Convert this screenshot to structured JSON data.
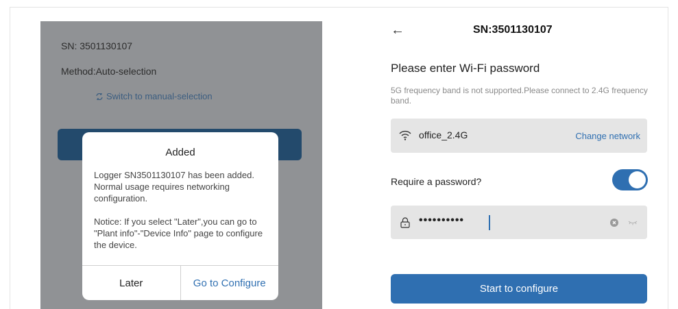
{
  "left": {
    "sn_text": "SN: 3501130107",
    "method_text": "Method:Auto-selection",
    "switch_label": "Switch to manual-selection",
    "dialog": {
      "title": "Added",
      "message": "Logger SN3501130107 has been added. Normal usage requires networking configuration.",
      "notice": "Notice: If you select \"Later\",you can go to \"Plant info\"-\"Device Info\" page to configure the device.",
      "later_label": "Later",
      "configure_label": "Go to Configure"
    }
  },
  "right": {
    "back_icon": "←",
    "header_title": "SN:3501130107",
    "title": "Please enter Wi-Fi password",
    "subtitle": "5G frequency band is not supported.Please connect to 2.4G frequency band.",
    "ssid": "office_2.4G",
    "change_network_label": "Change network",
    "require_password_label": "Require a password?",
    "require_password_enabled": true,
    "password_masked": "••••••••••",
    "start_label": "Start to configure"
  },
  "colors": {
    "accent": "#2f6fb1",
    "overlay": "#909295",
    "dark_button": "#234a6c",
    "field_bg": "#e5e5e5"
  },
  "icons": [
    "back-arrow-icon",
    "wifi-icon",
    "lock-icon",
    "clear-icon",
    "eye-closed-icon",
    "switch-icon"
  ]
}
